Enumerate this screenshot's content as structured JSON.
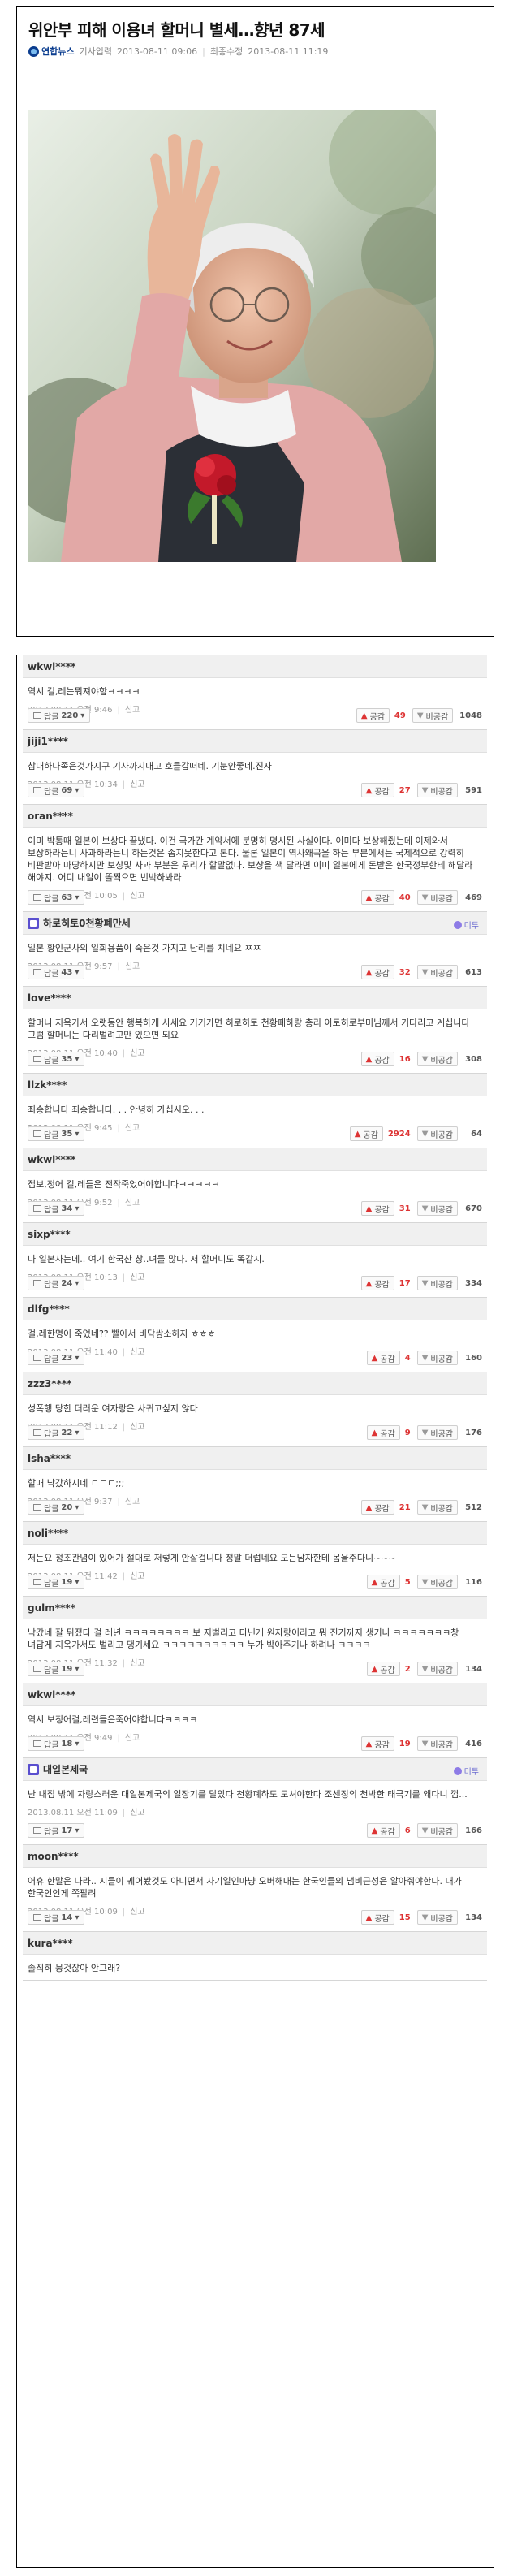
{
  "article": {
    "title": "위안부 피해 이용녀 할머니 별세…향년 87세",
    "source": "연합뉴스",
    "published_label": "기사입력",
    "published": "2013-08-11 09:06",
    "modified_label": "최종수정",
    "modified": "2013-08-11 11:19"
  },
  "ui": {
    "reply_label": "답글",
    "like_label": "공감",
    "dislike_label": "비공감",
    "report_label": "신고",
    "mirror_label": "미투"
  },
  "comments": [
    {
      "user": "wkwl****",
      "text": "역시 걸,레는뭐져야함ㅋㅋㅋㅋ",
      "date": "2013.08.11 오전 9:46",
      "replies": "220",
      "likes": "49",
      "dislikes": "1048"
    },
    {
      "user": "jiji1****",
      "text": "참내하나족은것가지구 기사까지내고 호들갑떠네. 기분안좋네.진자",
      "date": "2013.08.11 오전 10:34",
      "replies": "69",
      "likes": "27",
      "dislikes": "591"
    },
    {
      "user": "oran****",
      "text": "이미 박통때 일본이 보상다 끝냈다. 이건 국가간 계약서에 분명히 명시된 사실이다. 이미다 보상해줬는데 이제와서 보상하라는니 사과하라는니 하는것은 좀지못한다고 본다. 물론 일본이 역사왜곡을 하는 부분에서는 국제적으로 강력히 비판받아 마땅하지만 보상및 사과 부분은 우리가 할말없다. 보상을 책 달라면 이미 일본에게 돈받은 한국정부한테 해달라 해야지. 어디 내일이 똘쩍으면 빈박하봐라",
      "date": "2013.08.11 오전 10:05",
      "replies": "63",
      "likes": "40",
      "dislikes": "469"
    },
    {
      "user": "하로히토0천황폐만세",
      "badge": true,
      "mirror": true,
      "text": "일본 황인군사의 일회용품이 죽은것 가지고 난리를 치네요 ㅉㅉ",
      "date": "2013.08.11 오전 9:57",
      "replies": "43",
      "likes": "32",
      "dislikes": "613"
    },
    {
      "user": "love****",
      "text": "할머니 지옥가서 오랫동안 행복하게 사세요 거기가면 히로히토 천황폐하랑 총리 이토히로부미님께서 기다리고 계십니다 그럼 할머니는 다리벌려고만 있으면 되요",
      "date": "2013.08.11 오전 10:40",
      "replies": "35",
      "likes": "16",
      "dislikes": "308"
    },
    {
      "user": "llzk****",
      "text": "죄송합니다 죄송합니다. . . 안녕히 가십시오. . .",
      "date": "2013.08.11 오전 9:45",
      "replies": "35",
      "likes": "2924",
      "dislikes": "64"
    },
    {
      "user": "wkwl****",
      "text": "접보,정어 걸,레들은 전작죽었어야합니다ㅋㅋㅋㅋㅋ",
      "date": "2013.08.11 오전 9:52",
      "replies": "34",
      "likes": "31",
      "dislikes": "670"
    },
    {
      "user": "sixp****",
      "text": "나 일본사는데.. 여기 한국산 창..녀들 많다. 저 할머니도 똑같지.",
      "date": "2013.08.11 오전 10:13",
      "replies": "24",
      "likes": "17",
      "dislikes": "334"
    },
    {
      "user": "dlfg****",
      "text": "걸,레한명이 죽었네?? 빨아서 비닥쌍소하자 ㅎㅎㅎ",
      "date": "2013.08.11 오전 11:40",
      "replies": "23",
      "likes": "4",
      "dislikes": "160"
    },
    {
      "user": "zzz3****",
      "text": "성폭행 당한 더러운 여자랑은 사귀고싶지 않다",
      "date": "2013.08.11 오전 11:12",
      "replies": "22",
      "likes": "9",
      "dislikes": "176"
    },
    {
      "user": "lsha****",
      "text": "할매 낙갔하시네 ㄷㄷㄷ;;;",
      "date": "2013.08.11 오전 9:37",
      "replies": "20",
      "likes": "21",
      "dislikes": "512"
    },
    {
      "user": "noli****",
      "text": "저는요 정조관념이 있어가 절대로 저렇게 안살겁니다 정말 더럽네요 모든남자한테 몸을주다니~~~",
      "date": "2013.08.11 오전 11:42",
      "replies": "19",
      "likes": "5",
      "dislikes": "116"
    },
    {
      "user": "gulm****",
      "text": "낙갔네 잘 뒤졌다 걸 레년 ㅋㅋㅋㅋㅋㅋㅋㅋ 보 지벌리고 다닌게 원자랑이라고 뭐 진거까지 생기나 ㅋㅋㅋㅋㅋㅋㅋ창 녀답게 지옥가서도 벌리고 댕기세요 ㅋㅋㅋㅋㅋㅋㅋㅋㅋㅋ 누가 박아주기나 하려나 ㅋㅋㅋㅋ",
      "date": "2013.08.11 오전 11:32",
      "replies": "19",
      "likes": "2",
      "dislikes": "134"
    },
    {
      "user": "wkwl****",
      "text": "역시 보징어걸,레련들은죽어야합니다ㅋㅋㅋㅋ",
      "date": "2013.08.11 오전 9:49",
      "replies": "18",
      "likes": "19",
      "dislikes": "416"
    },
    {
      "user": "대일본제국",
      "badge": true,
      "mirror": true,
      "text": "난 내집 밖에 자랑스러운 대일본제국의 일장기를 달았다 천황폐하도 모셔야한다 조센징의 천박한 태극기를 왜다니 껍...",
      "date": "2013.08.11 오전 11:09",
      "replies": "17",
      "likes": "6",
      "dislikes": "166"
    },
    {
      "user": "moon****",
      "text": "어휴 한말은 나라.. 지들이 궤어봤것도 아니면서 자기일인마냥 오버해대는 한국인들의 냄비근성은 알아줘야한다. 내가 한국인인게 쪽팔려",
      "date": "2013.08.11 오전 10:09",
      "replies": "14",
      "likes": "15",
      "dislikes": "134"
    },
    {
      "user": "kura****",
      "text": "솔직히 뭉것잖아 안그래?",
      "date": "",
      "replies": "",
      "likes": "",
      "dislikes": ""
    }
  ]
}
